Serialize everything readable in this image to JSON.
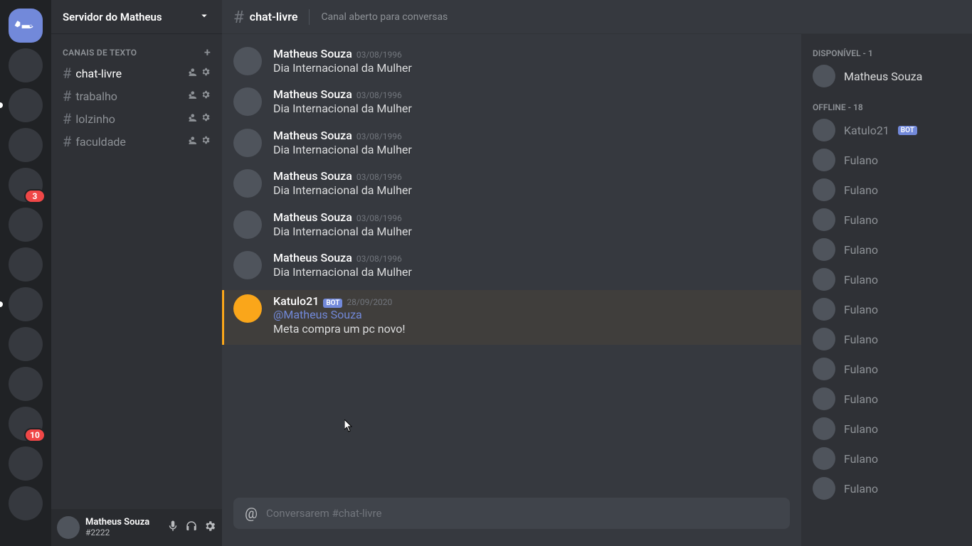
{
  "server": {
    "name": "Servidor do Matheus"
  },
  "guild_badges": [
    "3",
    "10"
  ],
  "channels": {
    "section_label": "CANAIS DE TEXTO",
    "items": [
      {
        "label": "chat-livre",
        "active": true
      },
      {
        "label": "trabalho",
        "active": false
      },
      {
        "label": "lolzinho",
        "active": false
      },
      {
        "label": "faculdade",
        "active": false
      }
    ]
  },
  "header": {
    "channel": "chat-livre",
    "topic": "Canal aberto para conversas"
  },
  "messages": [
    {
      "author": "Matheus Souza",
      "ts": "03/08/1996",
      "text": "Dia Internacional da Mulher"
    },
    {
      "author": "Matheus Souza",
      "ts": "03/08/1996",
      "text": "Dia Internacional da Mulher"
    },
    {
      "author": "Matheus Souza",
      "ts": "03/08/1996",
      "text": "Dia Internacional da Mulher"
    },
    {
      "author": "Matheus Souza",
      "ts": "03/08/1996",
      "text": "Dia Internacional da Mulher"
    },
    {
      "author": "Matheus Souza",
      "ts": "03/08/1996",
      "text": "Dia Internacional da Mulher"
    },
    {
      "author": "Matheus Souza",
      "ts": "03/08/1996",
      "text": "Dia Internacional da Mulher"
    },
    {
      "author": "Katulo21",
      "bot": "BOT",
      "ts": "28/09/2020",
      "mention": "@Matheus Souza",
      "text": "Meta compra um pc novo!",
      "highlight": true
    }
  ],
  "composer": {
    "placeholder": "Conversarem #chat-livre"
  },
  "members": {
    "online_label": "DISPONÍVEL - 1",
    "offline_label": "OFFLINE - 18",
    "online": [
      {
        "name": "Matheus Souza"
      }
    ],
    "offline": [
      {
        "name": "Katulo21",
        "bot": "BOT"
      },
      {
        "name": "Fulano"
      },
      {
        "name": "Fulano"
      },
      {
        "name": "Fulano"
      },
      {
        "name": "Fulano"
      },
      {
        "name": "Fulano"
      },
      {
        "name": "Fulano"
      },
      {
        "name": "Fulano"
      },
      {
        "name": "Fulano"
      },
      {
        "name": "Fulano"
      },
      {
        "name": "Fulano"
      },
      {
        "name": "Fulano"
      },
      {
        "name": "Fulano"
      }
    ]
  },
  "user": {
    "name": "Matheus Souza",
    "tag": "#2222"
  }
}
